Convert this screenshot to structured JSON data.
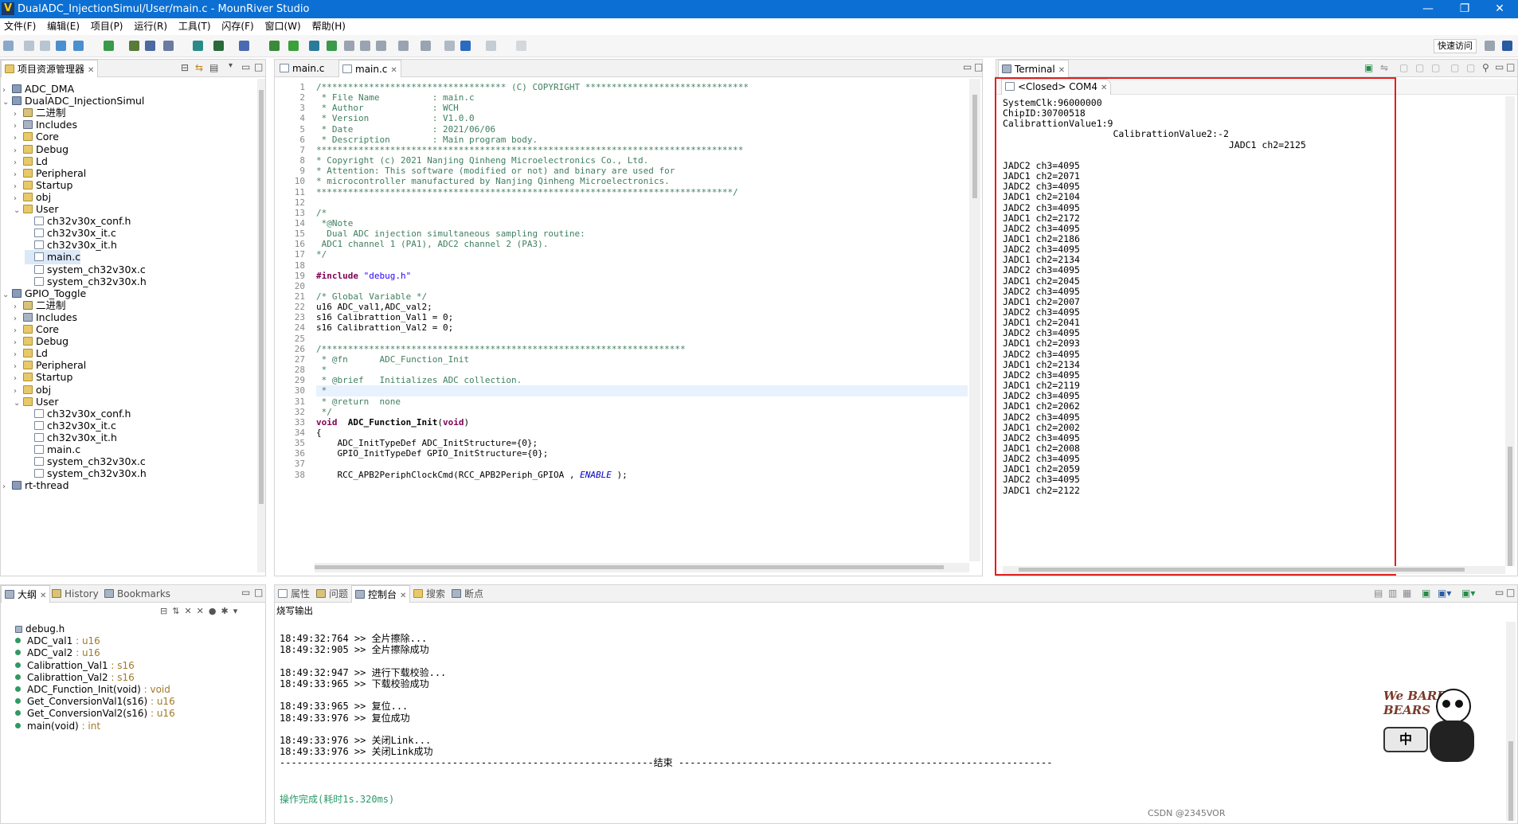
{
  "window": {
    "title": "DualADC_InjectionSimul/User/main.c - MounRiver Studio",
    "minimize": "—",
    "restore": "❐",
    "close": "✕"
  },
  "menu": [
    "文件(F)",
    "编辑(E)",
    "项目(P)",
    "运行(R)",
    "工具(T)",
    "闪存(F)",
    "窗口(W)",
    "帮助(H)"
  ],
  "toolbar": {
    "quick_access": "快速访问"
  },
  "explorer": {
    "title": "项目资源管理器",
    "items": [
      {
        "label": "ADC_DMA",
        "level": 0,
        "arrow": "›",
        "icon": "proj"
      },
      {
        "label": "DualADC_InjectionSimul",
        "level": 0,
        "arrow": "⌄",
        "icon": "proj"
      },
      {
        "label": "二进制",
        "level": 1,
        "arrow": "›",
        "icon": "bin"
      },
      {
        "label": "Includes",
        "level": 1,
        "arrow": "›",
        "icon": "inc"
      },
      {
        "label": "Core",
        "level": 1,
        "arrow": "›",
        "icon": "folder"
      },
      {
        "label": "Debug",
        "level": 1,
        "arrow": "›",
        "icon": "folder"
      },
      {
        "label": "Ld",
        "level": 1,
        "arrow": "›",
        "icon": "folder"
      },
      {
        "label": "Peripheral",
        "level": 1,
        "arrow": "›",
        "icon": "folder"
      },
      {
        "label": "Startup",
        "level": 1,
        "arrow": "›",
        "icon": "folder"
      },
      {
        "label": "obj",
        "level": 1,
        "arrow": "›",
        "icon": "folder"
      },
      {
        "label": "User",
        "level": 1,
        "arrow": "⌄",
        "icon": "folder"
      },
      {
        "label": "ch32v30x_conf.h",
        "level": 2,
        "arrow": "",
        "icon": "file"
      },
      {
        "label": "ch32v30x_it.c",
        "level": 2,
        "arrow": "",
        "icon": "file"
      },
      {
        "label": "ch32v30x_it.h",
        "level": 2,
        "arrow": "",
        "icon": "file"
      },
      {
        "label": "main.c",
        "level": 2,
        "arrow": "",
        "icon": "file",
        "selected": true
      },
      {
        "label": "system_ch32v30x.c",
        "level": 2,
        "arrow": "",
        "icon": "file"
      },
      {
        "label": "system_ch32v30x.h",
        "level": 2,
        "arrow": "",
        "icon": "file"
      },
      {
        "label": "GPIO_Toggle",
        "level": 0,
        "arrow": "⌄",
        "icon": "proj"
      },
      {
        "label": "二进制",
        "level": 1,
        "arrow": "›",
        "icon": "bin"
      },
      {
        "label": "Includes",
        "level": 1,
        "arrow": "›",
        "icon": "inc"
      },
      {
        "label": "Core",
        "level": 1,
        "arrow": "›",
        "icon": "folder"
      },
      {
        "label": "Debug",
        "level": 1,
        "arrow": "›",
        "icon": "folder"
      },
      {
        "label": "Ld",
        "level": 1,
        "arrow": "›",
        "icon": "folder"
      },
      {
        "label": "Peripheral",
        "level": 1,
        "arrow": "›",
        "icon": "folder"
      },
      {
        "label": "Startup",
        "level": 1,
        "arrow": "›",
        "icon": "folder"
      },
      {
        "label": "obj",
        "level": 1,
        "arrow": "›",
        "icon": "folder"
      },
      {
        "label": "User",
        "level": 1,
        "arrow": "⌄",
        "icon": "folder"
      },
      {
        "label": "ch32v30x_conf.h",
        "level": 2,
        "arrow": "",
        "icon": "file"
      },
      {
        "label": "ch32v30x_it.c",
        "level": 2,
        "arrow": "",
        "icon": "file"
      },
      {
        "label": "ch32v30x_it.h",
        "level": 2,
        "arrow": "",
        "icon": "file"
      },
      {
        "label": "main.c",
        "level": 2,
        "arrow": "",
        "icon": "file"
      },
      {
        "label": "system_ch32v30x.c",
        "level": 2,
        "arrow": "",
        "icon": "file"
      },
      {
        "label": "system_ch32v30x.h",
        "level": 2,
        "arrow": "",
        "icon": "file"
      },
      {
        "label": "rt-thread",
        "level": 0,
        "arrow": "›",
        "icon": "proj"
      }
    ]
  },
  "editor": {
    "tabs": [
      "main.c",
      "main.c"
    ],
    "lines": [
      [
        {
          "t": "/*********************************** (C) COPYRIGHT *******************************",
          "c": "cm"
        }
      ],
      [
        {
          "t": " * File Name          : main.c",
          "c": "cm"
        }
      ],
      [
        {
          "t": " * Author             : WCH",
          "c": "cm"
        }
      ],
      [
        {
          "t": " * Version            : V1.0.0",
          "c": "cm"
        }
      ],
      [
        {
          "t": " * Date               : 2021/06/06",
          "c": "cm"
        }
      ],
      [
        {
          "t": " * Description        : Main program body.",
          "c": "cm"
        }
      ],
      [
        {
          "t": "*********************************************************************************",
          "c": "cm"
        }
      ],
      [
        {
          "t": "* Copyright (c) 2021 Nanjing Qinheng Microelectronics Co., Ltd.",
          "c": "cm"
        }
      ],
      [
        {
          "t": "* Attention: This software (modified or not) and binary are used for",
          "c": "cm"
        }
      ],
      [
        {
          "t": "* microcontroller manufactured by Nanjing Qinheng Microelectronics.",
          "c": "cm"
        }
      ],
      [
        {
          "t": "*******************************************************************************/",
          "c": "cm"
        }
      ],
      [],
      [
        {
          "t": "/*",
          "c": "cm"
        }
      ],
      [
        {
          "t": " *@Note",
          "c": "cm"
        }
      ],
      [
        {
          "t": "  Dual ADC injection simultaneous sampling routine:",
          "c": "cm"
        }
      ],
      [
        {
          "t": " ADC1 channel 1 (PA1), ADC2 channel 2 (PA3).",
          "c": "cm"
        }
      ],
      [
        {
          "t": "*/",
          "c": "cm"
        }
      ],
      [],
      [
        {
          "t": "#include ",
          "c": "kw"
        },
        {
          "t": "\"debug.h\"",
          "c": "str"
        }
      ],
      [],
      [
        {
          "t": "/* Global Variable */",
          "c": "cm"
        }
      ],
      [
        {
          "t": "u16 ADC_val1,ADC_val2;",
          "c": ""
        }
      ],
      [
        {
          "t": "s16 Calibrattion_Val1 = 0;",
          "c": ""
        }
      ],
      [
        {
          "t": "s16 Calibrattion_Val2 = 0;",
          "c": ""
        }
      ],
      [],
      [
        {
          "t": "/*********************************************************************",
          "c": "cm"
        }
      ],
      [
        {
          "t": " * @fn      ADC_Function_Init",
          "c": "cm"
        }
      ],
      [
        {
          "t": " *",
          "c": "cm"
        }
      ],
      [
        {
          "t": " * @brief   Initializes ADC collection.",
          "c": "cm"
        }
      ],
      [
        {
          "t": " *",
          "c": "cm"
        }
      ],
      [
        {
          "t": " * @return  none",
          "c": "cm"
        }
      ],
      [
        {
          "t": " */",
          "c": "cm"
        }
      ],
      [
        {
          "t": "void ",
          "c": "kw"
        },
        {
          "t": " ADC_Function_Init",
          "c": "b"
        },
        {
          "t": "(",
          "c": ""
        },
        {
          "t": "void",
          "c": "kw"
        },
        {
          "t": ")",
          "c": ""
        }
      ],
      [
        {
          "t": "{",
          "c": ""
        }
      ],
      [
        {
          "t": "    ADC_InitTypeDef ADC_InitStructure={0};",
          "c": ""
        }
      ],
      [
        {
          "t": "    GPIO_InitTypeDef GPIO_InitStructure={0};",
          "c": ""
        }
      ],
      [],
      [
        {
          "t": "    RCC_APB2PeriphClockCmd(RCC_APB2Periph_GPIOA , ",
          "c": ""
        },
        {
          "t": "ENABLE",
          "c": "it"
        },
        {
          "t": " );",
          "c": ""
        }
      ]
    ]
  },
  "terminal": {
    "title": "Terminal",
    "session": "<Closed> COM4",
    "lines": [
      "SystemClk:96000000",
      "ChipID:30700518",
      "CalibrattionValue1:9",
      "                    CalibrattionValue2:-2",
      "                                         JADC1 ch2=2125",
      "",
      "JADC2 ch3=4095",
      "JADC1 ch2=2071",
      "JADC2 ch3=4095",
      "JADC1 ch2=2104",
      "JADC2 ch3=4095",
      "JADC1 ch2=2172",
      "JADC2 ch3=4095",
      "JADC1 ch2=2186",
      "JADC2 ch3=4095",
      "JADC1 ch2=2134",
      "JADC2 ch3=4095",
      "JADC1 ch2=2045",
      "JADC2 ch3=4095",
      "JADC1 ch2=2007",
      "JADC2 ch3=4095",
      "JADC1 ch2=2041",
      "JADC2 ch3=4095",
      "JADC1 ch2=2093",
      "JADC2 ch3=4095",
      "JADC1 ch2=2134",
      "JADC2 ch3=4095",
      "JADC1 ch2=2119",
      "JADC2 ch3=4095",
      "JADC1 ch2=2062",
      "JADC2 ch3=4095",
      "JADC1 ch2=2002",
      "JADC2 ch3=4095",
      "JADC1 ch2=2008",
      "JADC2 ch3=4095",
      "JADC1 ch2=2059",
      "JADC2 ch3=4095",
      "JADC1 ch2=2122"
    ]
  },
  "outline": {
    "tabs": [
      "大纲",
      "History",
      "Bookmarks"
    ],
    "items": [
      {
        "name": "debug.h",
        "type": "",
        "kind": "include"
      },
      {
        "name": "ADC_val1",
        "type": " : u16",
        "kind": "var"
      },
      {
        "name": "ADC_val2",
        "type": " : u16",
        "kind": "var"
      },
      {
        "name": "Calibrattion_Val1",
        "type": " : s16",
        "kind": "var"
      },
      {
        "name": "Calibrattion_Val2",
        "type": " : s16",
        "kind": "var"
      },
      {
        "name": "ADC_Function_Init(void)",
        "type": " : void",
        "kind": "fn"
      },
      {
        "name": "Get_ConversionVal1(s16)",
        "type": " : u16",
        "kind": "fn"
      },
      {
        "name": "Get_ConversionVal2(s16)",
        "type": " : u16",
        "kind": "fn"
      },
      {
        "name": "main(void)",
        "type": " : int",
        "kind": "fn"
      }
    ]
  },
  "console": {
    "tabs": [
      "属性",
      "问题",
      "控制台",
      "搜索",
      "断点"
    ],
    "subtitle": "烧写输出",
    "lines": [
      "",
      "18:49:32:764 >> 全片擦除...",
      "18:49:32:905 >> 全片擦除成功",
      "",
      "18:49:32:947 >> 进行下载校验...",
      "18:49:33:965 >> 下载校验成功",
      "",
      "18:49:33:965 >> 复位...",
      "18:49:33:976 >> 复位成功",
      "",
      "18:49:33:976 >> 关闭Link...",
      "18:49:33:976 >> 关闭Link成功",
      "-----------------------------------------------------------------结束 -----------------------------------------------------------------"
    ],
    "done": "操作完成(耗时1s.320ms)"
  },
  "watermark": {
    "csdn": "CSDN @2345VOR",
    "sticker_text": "We BARE BEARS",
    "sticker_char": "中"
  },
  "colors": {
    "accent": "#0c6fd3",
    "highlight_border": "#e02020",
    "comment": "#3f7f5f",
    "keyword": "#7f0055",
    "string": "#2a00ff"
  }
}
